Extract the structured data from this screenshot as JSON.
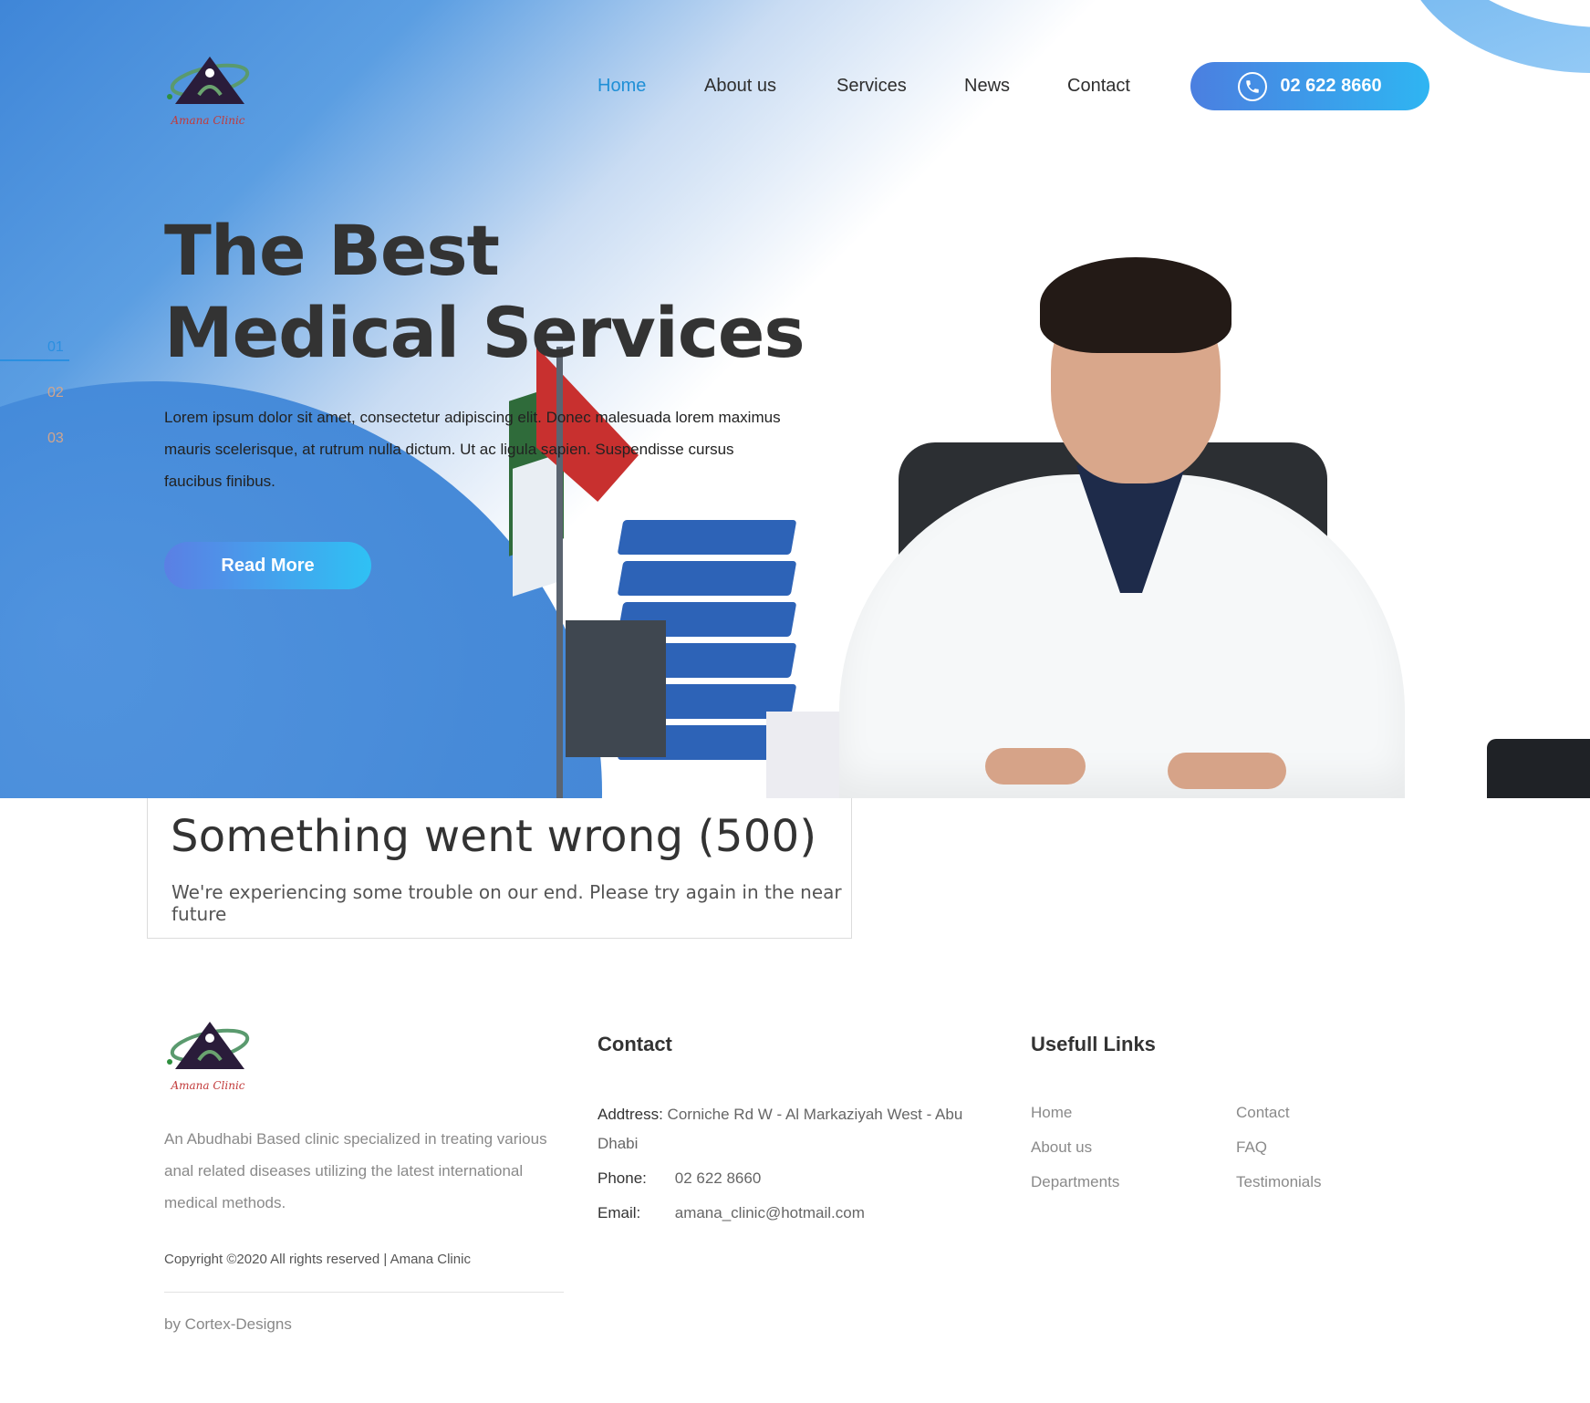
{
  "header": {
    "logo_text": "Amana Clinic",
    "nav": [
      "Home",
      "About us",
      "Services",
      "News",
      "Contact"
    ],
    "active_index": 0,
    "phone_button": "02 622 8660"
  },
  "hero": {
    "title_line1": "The Best",
    "title_line2": "Medical Services",
    "text": "Lorem ipsum dolor sit amet, consectetur adipiscing elit. Donec malesuada lorem maximus mauris scelerisque, at rutrum nulla dictum. Ut ac ligula sapien. Suspendisse cursus faucibus finibus.",
    "cta": "Read More",
    "slides": [
      "01",
      "02",
      "03"
    ],
    "active_slide": 0
  },
  "error": {
    "title": "Something went wrong (500)",
    "message": "We're experiencing some trouble on our end. Please try again in the near future"
  },
  "footer": {
    "logo_text": "Amana Clinic",
    "description": "An Abudhabi Based clinic specialized in treating various anal related diseases utilizing the latest international medical methods.",
    "copyright": "Copyright ©2020 All rights reserved | Amana Clinic",
    "credit": "by Cortex-Designs",
    "contact": {
      "heading": "Contact",
      "address_label": "Addtress:",
      "address_value": "Corniche Rd W - Al Markaziyah West - Abu Dhabi",
      "phone_label": "Phone:",
      "phone_value": "02 622 8660",
      "email_label": "Email:",
      "email_value": "amana_clinic@hotmail.com"
    },
    "links": {
      "heading": "Usefull Links",
      "col1": [
        "Home",
        "About us",
        "Departments"
      ],
      "col2": [
        "Contact",
        "FAQ",
        "Testimonials"
      ]
    }
  },
  "colors": {
    "accent": "#1f8fd6",
    "button_gradient_start": "#4b7fe0",
    "button_gradient_end": "#2fb5f2",
    "hero_blue": "#3d84d6"
  },
  "icons": [
    "logo-icon",
    "phone-icon"
  ]
}
